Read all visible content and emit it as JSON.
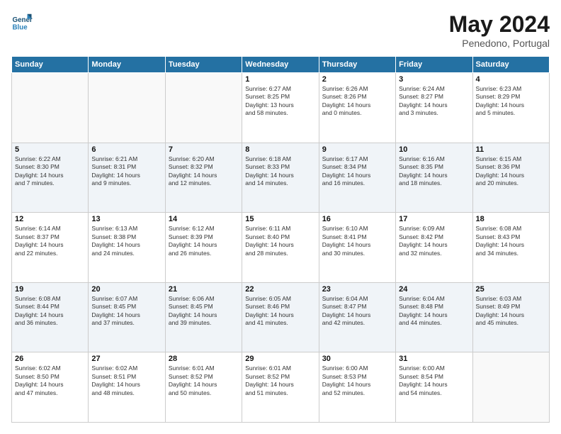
{
  "header": {
    "logo_line1": "General",
    "logo_line2": "Blue",
    "month": "May 2024",
    "location": "Penedono, Portugal"
  },
  "days_of_week": [
    "Sunday",
    "Monday",
    "Tuesday",
    "Wednesday",
    "Thursday",
    "Friday",
    "Saturday"
  ],
  "weeks": [
    [
      {
        "day": "",
        "content": ""
      },
      {
        "day": "",
        "content": ""
      },
      {
        "day": "",
        "content": ""
      },
      {
        "day": "1",
        "content": "Sunrise: 6:27 AM\nSunset: 8:25 PM\nDaylight: 13 hours\nand 58 minutes."
      },
      {
        "day": "2",
        "content": "Sunrise: 6:26 AM\nSunset: 8:26 PM\nDaylight: 14 hours\nand 0 minutes."
      },
      {
        "day": "3",
        "content": "Sunrise: 6:24 AM\nSunset: 8:27 PM\nDaylight: 14 hours\nand 3 minutes."
      },
      {
        "day": "4",
        "content": "Sunrise: 6:23 AM\nSunset: 8:29 PM\nDaylight: 14 hours\nand 5 minutes."
      }
    ],
    [
      {
        "day": "5",
        "content": "Sunrise: 6:22 AM\nSunset: 8:30 PM\nDaylight: 14 hours\nand 7 minutes."
      },
      {
        "day": "6",
        "content": "Sunrise: 6:21 AM\nSunset: 8:31 PM\nDaylight: 14 hours\nand 9 minutes."
      },
      {
        "day": "7",
        "content": "Sunrise: 6:20 AM\nSunset: 8:32 PM\nDaylight: 14 hours\nand 12 minutes."
      },
      {
        "day": "8",
        "content": "Sunrise: 6:18 AM\nSunset: 8:33 PM\nDaylight: 14 hours\nand 14 minutes."
      },
      {
        "day": "9",
        "content": "Sunrise: 6:17 AM\nSunset: 8:34 PM\nDaylight: 14 hours\nand 16 minutes."
      },
      {
        "day": "10",
        "content": "Sunrise: 6:16 AM\nSunset: 8:35 PM\nDaylight: 14 hours\nand 18 minutes."
      },
      {
        "day": "11",
        "content": "Sunrise: 6:15 AM\nSunset: 8:36 PM\nDaylight: 14 hours\nand 20 minutes."
      }
    ],
    [
      {
        "day": "12",
        "content": "Sunrise: 6:14 AM\nSunset: 8:37 PM\nDaylight: 14 hours\nand 22 minutes."
      },
      {
        "day": "13",
        "content": "Sunrise: 6:13 AM\nSunset: 8:38 PM\nDaylight: 14 hours\nand 24 minutes."
      },
      {
        "day": "14",
        "content": "Sunrise: 6:12 AM\nSunset: 8:39 PM\nDaylight: 14 hours\nand 26 minutes."
      },
      {
        "day": "15",
        "content": "Sunrise: 6:11 AM\nSunset: 8:40 PM\nDaylight: 14 hours\nand 28 minutes."
      },
      {
        "day": "16",
        "content": "Sunrise: 6:10 AM\nSunset: 8:41 PM\nDaylight: 14 hours\nand 30 minutes."
      },
      {
        "day": "17",
        "content": "Sunrise: 6:09 AM\nSunset: 8:42 PM\nDaylight: 14 hours\nand 32 minutes."
      },
      {
        "day": "18",
        "content": "Sunrise: 6:08 AM\nSunset: 8:43 PM\nDaylight: 14 hours\nand 34 minutes."
      }
    ],
    [
      {
        "day": "19",
        "content": "Sunrise: 6:08 AM\nSunset: 8:44 PM\nDaylight: 14 hours\nand 36 minutes."
      },
      {
        "day": "20",
        "content": "Sunrise: 6:07 AM\nSunset: 8:45 PM\nDaylight: 14 hours\nand 37 minutes."
      },
      {
        "day": "21",
        "content": "Sunrise: 6:06 AM\nSunset: 8:45 PM\nDaylight: 14 hours\nand 39 minutes."
      },
      {
        "day": "22",
        "content": "Sunrise: 6:05 AM\nSunset: 8:46 PM\nDaylight: 14 hours\nand 41 minutes."
      },
      {
        "day": "23",
        "content": "Sunrise: 6:04 AM\nSunset: 8:47 PM\nDaylight: 14 hours\nand 42 minutes."
      },
      {
        "day": "24",
        "content": "Sunrise: 6:04 AM\nSunset: 8:48 PM\nDaylight: 14 hours\nand 44 minutes."
      },
      {
        "day": "25",
        "content": "Sunrise: 6:03 AM\nSunset: 8:49 PM\nDaylight: 14 hours\nand 45 minutes."
      }
    ],
    [
      {
        "day": "26",
        "content": "Sunrise: 6:02 AM\nSunset: 8:50 PM\nDaylight: 14 hours\nand 47 minutes."
      },
      {
        "day": "27",
        "content": "Sunrise: 6:02 AM\nSunset: 8:51 PM\nDaylight: 14 hours\nand 48 minutes."
      },
      {
        "day": "28",
        "content": "Sunrise: 6:01 AM\nSunset: 8:52 PM\nDaylight: 14 hours\nand 50 minutes."
      },
      {
        "day": "29",
        "content": "Sunrise: 6:01 AM\nSunset: 8:52 PM\nDaylight: 14 hours\nand 51 minutes."
      },
      {
        "day": "30",
        "content": "Sunrise: 6:00 AM\nSunset: 8:53 PM\nDaylight: 14 hours\nand 52 minutes."
      },
      {
        "day": "31",
        "content": "Sunrise: 6:00 AM\nSunset: 8:54 PM\nDaylight: 14 hours\nand 54 minutes."
      },
      {
        "day": "",
        "content": ""
      }
    ]
  ]
}
